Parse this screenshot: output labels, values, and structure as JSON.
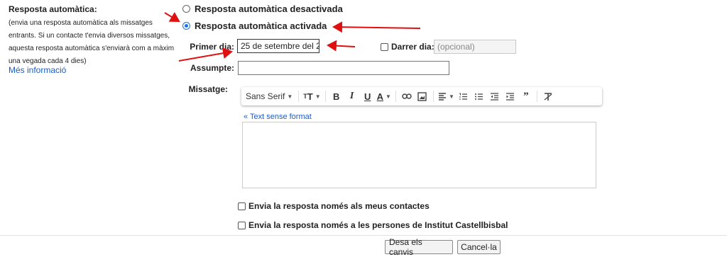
{
  "left": {
    "title": "Resposta automàtica:",
    "description": "(envia una resposta automàtica als missatges entrants. Si un contacte t'envia diversos missatges, aquesta resposta automàtica s'enviarà com a màxim una vegada cada 4 dies)",
    "more_info": "Més informació"
  },
  "options": {
    "off_label": "Resposta automàtica desactivada",
    "on_label": "Resposta automàtica activada",
    "selected": "on"
  },
  "fields": {
    "first_day_label": "Primer dia:",
    "first_day_value": "25 de setembre del 2",
    "last_day_label": "Darrer dia:",
    "last_day_placeholder": "(opcional)",
    "subject_label": "Assumpte:",
    "subject_value": "",
    "message_label": "Missatge:"
  },
  "toolbar": {
    "font": "Sans Serif",
    "icons": [
      "font-size-icon",
      "bold-icon",
      "italic-icon",
      "underline-icon",
      "text-color-icon",
      "link-icon",
      "image-icon",
      "align-icon",
      "numbered-list-icon",
      "bulleted-list-icon",
      "indent-less-icon",
      "indent-more-icon",
      "quote-icon",
      "remove-formatting-icon"
    ]
  },
  "plain_text_link": "« Text sense format",
  "checkboxes": {
    "contacts_only": "Envia la resposta només als meus contactes",
    "org_only": "Envia la resposta només a les persones de Institut Castellbisbal"
  },
  "buttons": {
    "save": "Desa els canvis",
    "cancel": "Cancel·la"
  },
  "colors": {
    "annotation_arrow": "#e01010",
    "link": "#1a5dc8",
    "radio_selected": "#1a73e8"
  }
}
